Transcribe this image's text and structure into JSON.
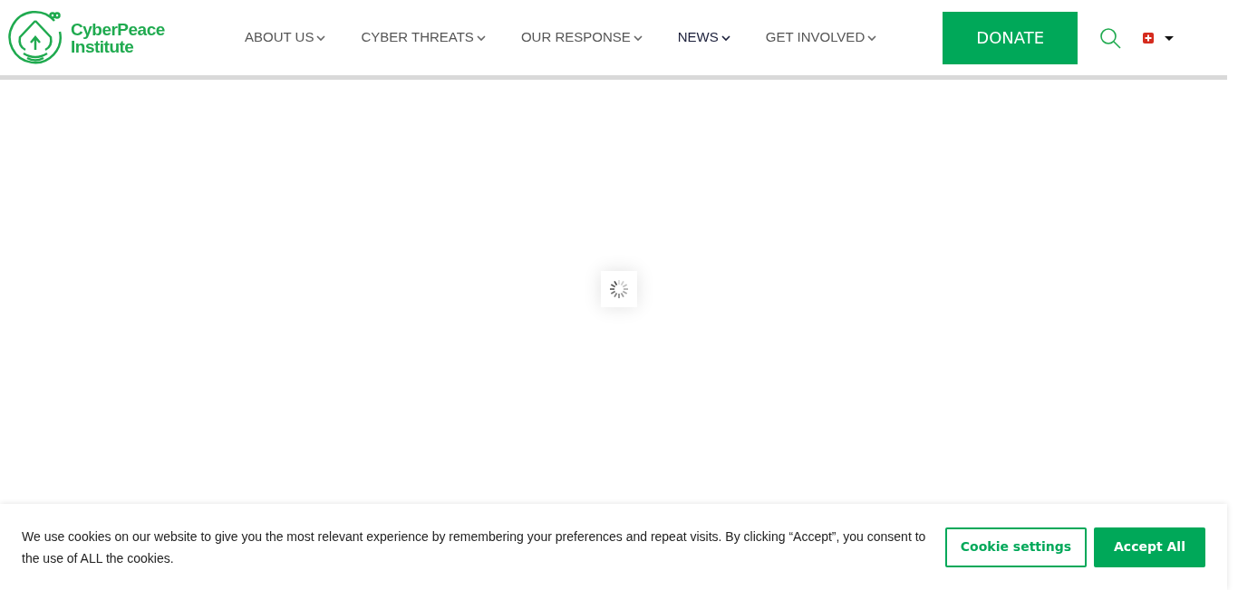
{
  "logo": {
    "lines": [
      "CyberPeace",
      "Institute"
    ]
  },
  "nav": [
    {
      "label": "ABOUT US",
      "selected": false
    },
    {
      "label": "CYBER THREATS",
      "selected": false
    },
    {
      "label": "OUR RESPONSE",
      "selected": false
    },
    {
      "label": "NEWS",
      "selected": true
    },
    {
      "label": "GET INVOLVED",
      "selected": false
    }
  ],
  "donate": "DONATE",
  "cookie_banner": {
    "text": "We use cookies on our website to give you the most relevant experience by remembering your preferences and repeat visits. By clicking “Accept”, you consent to the use of ALL the cookies.",
    "buttons": [
      {
        "label": "Cookie settings",
        "kind": "outline"
      },
      {
        "label": "Accept All",
        "kind": "solid"
      }
    ]
  }
}
